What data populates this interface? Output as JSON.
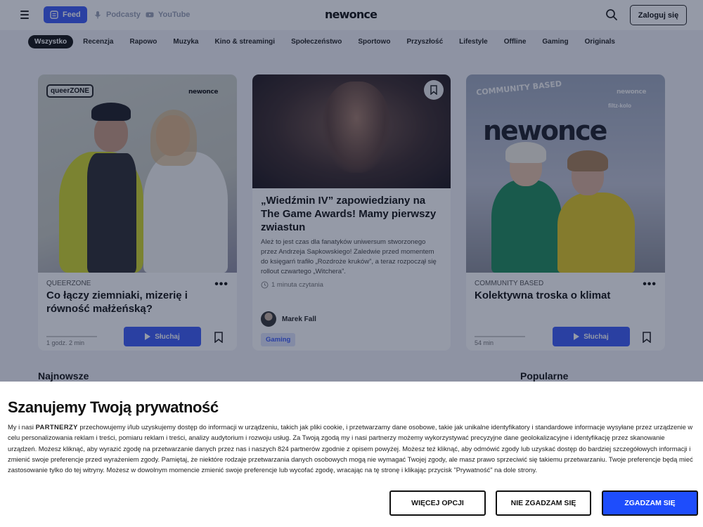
{
  "header": {
    "tabs": [
      {
        "label": "Feed",
        "icon": "feed-icon",
        "active": true
      },
      {
        "label": "Podcasty",
        "icon": "microphone-icon",
        "active": false
      },
      {
        "label": "YouTube",
        "icon": "youtube-icon",
        "active": false
      }
    ],
    "logo": "newonce",
    "login_label": "Zaloguj się"
  },
  "categories": [
    "Wszystko",
    "Recenzja",
    "Rapowo",
    "Muzyka",
    "Kino & streamingi",
    "Społeczeństwo",
    "Sportowo",
    "Przyszłość",
    "Lifestyle",
    "Offline",
    "Gaming",
    "Originals"
  ],
  "cards": [
    {
      "type": "podcast",
      "image_tag": "queerZONE",
      "image_logo": "newonce",
      "category": "QUEERZONE",
      "title": "Co łączy ziemniaki, mizerię i równość małżeńską?",
      "duration": "1 godz. 2 min",
      "listen_label": "Słuchaj",
      "progress": 0
    },
    {
      "type": "article",
      "title": "„Wiedźmin IV” zapowiedziany na The Game Awards! Mamy pierwszy zwiastun",
      "excerpt": "Ależ to jest czas dla fanatyków uniwersum stworzonego przez Andrzeja Sapkowskiego! Zaledwie przed momentem do księgarń trafiło „Rozdroże kruków”, a teraz rozpoczął się rollout czwartego „Witchera”.",
      "read_time": "1 minuta czytania",
      "author": "Marek Fall",
      "tag": "Gaming"
    },
    {
      "type": "podcast",
      "image_tag": "COMMUNITY BASED",
      "image_logo": "newonce",
      "image_partner": "filtz-kolo",
      "big_logo": "newonce",
      "category": "COMMUNITY BASED",
      "title": "Kolektywna troska o klimat",
      "duration": "54 min",
      "listen_label": "Słuchaj",
      "progress": 0
    }
  ],
  "sections": {
    "latest": "Najnowsze",
    "popular": "Popularne"
  },
  "consent": {
    "title": "Szanujemy Twoją prywatność",
    "text_prefix": "My i nasi ",
    "partners": "PARTNERZY",
    "text": " przechowujemy i/lub uzyskujemy dostęp do informacji w urządzeniu, takich jak pliki cookie, i przetwarzamy dane osobowe, takie jak unikalne identyfikatory i standardowe informacje wysyłane przez urządzenie w celu personalizowania reklam i treści, pomiaru reklam i treści, analizy audytorium i rozwoju usług. Za Twoją zgodą my i nasi partnerzy możemy wykorzystywać precyzyjne dane geolokalizacyjne i identyfikację przez skanowanie urządzeń. Możesz kliknąć, aby wyrazić zgodę na przetwarzanie danych przez nas i naszych 824 partnerów zgodnie z opisem powyżej. Możesz też kliknąć, aby odmówić zgody lub uzyskać dostęp do bardziej szczegółowych informacji i zmienić swoje preferencje przed wyrażeniem zgody. Pamiętaj, że niektóre rodzaje przetwarzania danych osobowych mogą nie wymagać Twojej zgody, ale masz prawo sprzeciwić się takiemu przetwarzaniu. Twoje preferencje będą mieć zastosowanie tylko do tej witryny. Możesz w dowolnym momencie zmienić swoje preferencje lub wycofać zgodę, wracając na tę stronę i klikając przycisk \"Prywatność\" na dole strony.",
    "more_options": "WIĘCEJ OPCJI",
    "reject": "NIE ZGADZAM SIĘ",
    "accept": "ZGADZAM SIĘ"
  },
  "colors": {
    "accent": "#3c5bf6",
    "accept_button": "#1e4dfc",
    "overlay": "rgba(20,30,60,0.45)"
  }
}
